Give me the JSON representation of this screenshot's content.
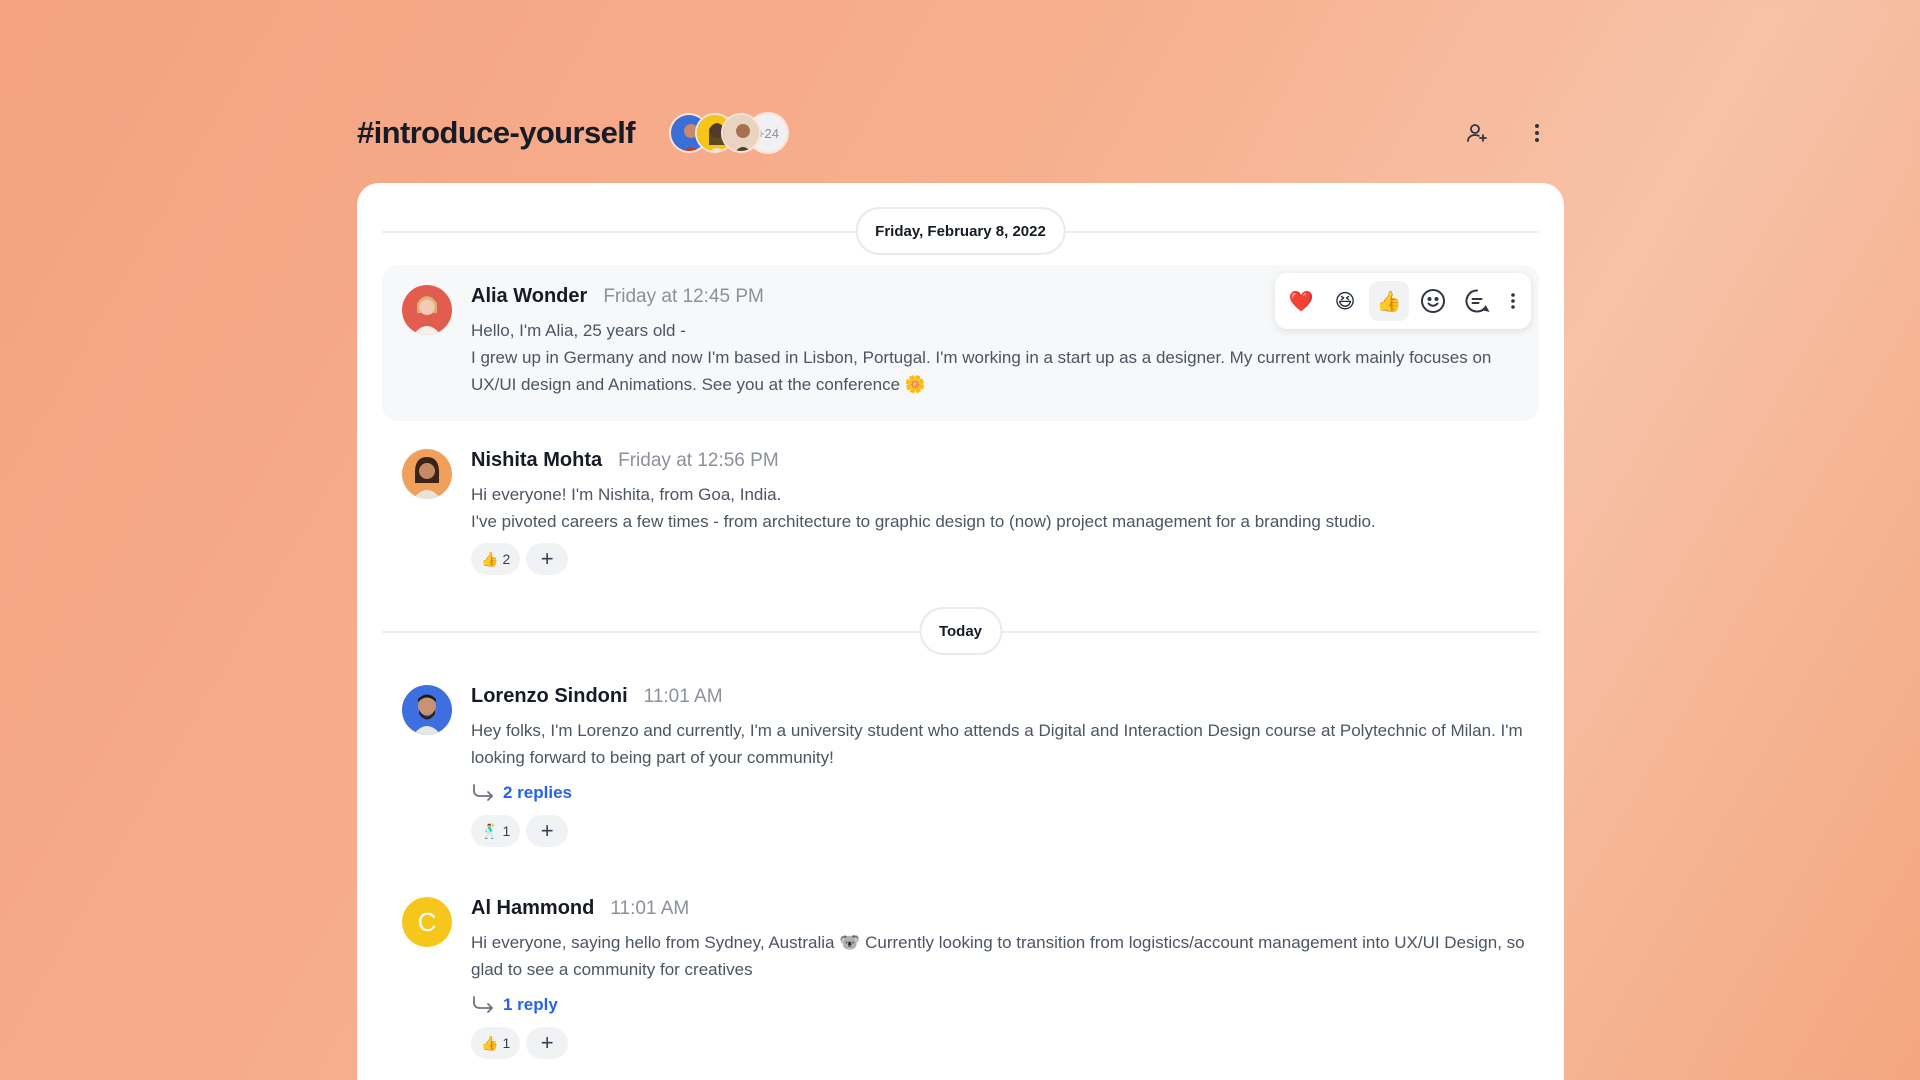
{
  "channel": {
    "title": "#introduce-yourself",
    "member_more": "+24"
  },
  "header_icons": [
    "add-member-icon",
    "more-vertical-icon"
  ],
  "date_separators": [
    "Friday, February 8, 2022",
    "Today"
  ],
  "messages": [
    {
      "name": "Alia Wonder",
      "time": "Friday at 12:45 PM",
      "lines": [
        "Hello, I'm Alia, 25 years old -",
        "I grew up in Germany and now I'm based in Lisbon, Portugal. I'm working in a start up as a designer. My current work mainly focuses on UX/UI design and Animations. See you at the conference 🌼"
      ],
      "toolbar": [
        "❤️",
        "😆",
        "👍"
      ]
    },
    {
      "name": "Nishita Mohta",
      "time": "Friday at 12:56 PM",
      "lines": [
        "Hi everyone! I'm Nishita, from Goa, India.",
        "I've pivoted careers a few times - from architecture to graphic design to (now) project management for a branding studio."
      ],
      "reactions": [
        {
          "emoji": "👍",
          "count": "2"
        }
      ]
    },
    {
      "name": "Lorenzo Sindoni",
      "time": "11:01 AM",
      "lines": [
        "Hey folks, I'm Lorenzo and currently, I'm a university student who attends a Digital and Interaction Design course at Polytechnic of Milan. I'm looking forward to being part of your community!"
      ],
      "replies": "2 replies",
      "reactions": [
        {
          "emoji": "🕺",
          "count": "1"
        }
      ]
    },
    {
      "name": "Al Hammond",
      "avatar_letter": "C",
      "time": "11:01 AM",
      "lines": [
        "Hi everyone, saying hello from Sydney, Australia 🐨 Currently looking to transition from logistics/account management into UX/UI Design, so glad to see a community for creatives"
      ],
      "replies": "1 reply",
      "reactions": [
        {
          "emoji": "👍",
          "count": "1"
        }
      ]
    }
  ],
  "add_reaction_label": "+",
  "colors": {
    "accent": "#2563eb",
    "avatar_yellow": "#f6c61b",
    "card_bg": "#ffffff"
  }
}
